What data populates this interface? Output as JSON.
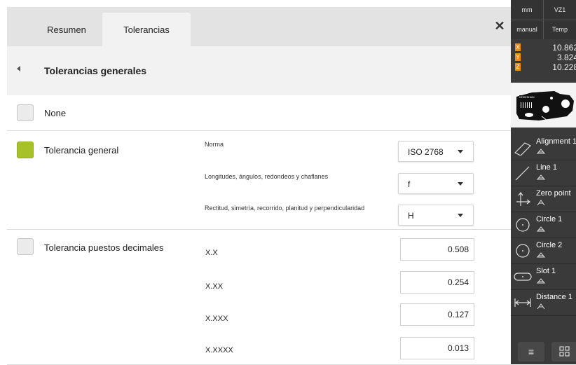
{
  "tabs": [
    {
      "label": "Resumen",
      "active": false
    },
    {
      "label": "Tolerancias",
      "active": true
    }
  ],
  "close_icon": "close-icon",
  "section": {
    "title": "Tolerancias generales"
  },
  "options": {
    "none": {
      "label": "None",
      "checked": false
    },
    "general": {
      "label": "Tolerancia general",
      "checked": true,
      "fields": [
        {
          "label": "Norma",
          "value": "ISO 2768"
        },
        {
          "label": "Longitudes, ángulos, redondeos y chaflanes",
          "value": "f"
        },
        {
          "label": "Rectitud, simetría, recorrido, planitud y perpendicularidad",
          "value": "H"
        }
      ]
    },
    "decimal": {
      "label": "Tolerancia puestos decimales",
      "checked": false,
      "fields": [
        {
          "label": "X.X",
          "value": "0.508"
        },
        {
          "label": "X.XX",
          "value": "0.254"
        },
        {
          "label": "X.XXX",
          "value": "0.127"
        },
        {
          "label": "X.XXXX",
          "value": "0.013"
        }
      ]
    }
  },
  "sidebar": {
    "unit": "mm",
    "vz": "VZ1",
    "mode": "manual",
    "temp": "Temp",
    "coords": [
      {
        "axis": "X",
        "value": "10.862"
      },
      {
        "axis": "Y",
        "value": "3.824"
      },
      {
        "axis": "Z",
        "value": "10.228"
      }
    ],
    "logo_text": "HEIDENHAIN",
    "features": [
      {
        "name": "Alignment 1",
        "icon": "alignment-icon"
      },
      {
        "name": "Line 1",
        "icon": "line-icon"
      },
      {
        "name": "Zero point",
        "icon": "zero-point-icon"
      },
      {
        "name": "Circle 1",
        "icon": "circle-icon"
      },
      {
        "name": "Circle 2",
        "icon": "circle-icon"
      },
      {
        "name": "Slot 1",
        "icon": "slot-icon"
      },
      {
        "name": "Distance 1",
        "icon": "distance-icon"
      }
    ],
    "accent": "#f08c14",
    "check_color": "#a7c12a"
  }
}
